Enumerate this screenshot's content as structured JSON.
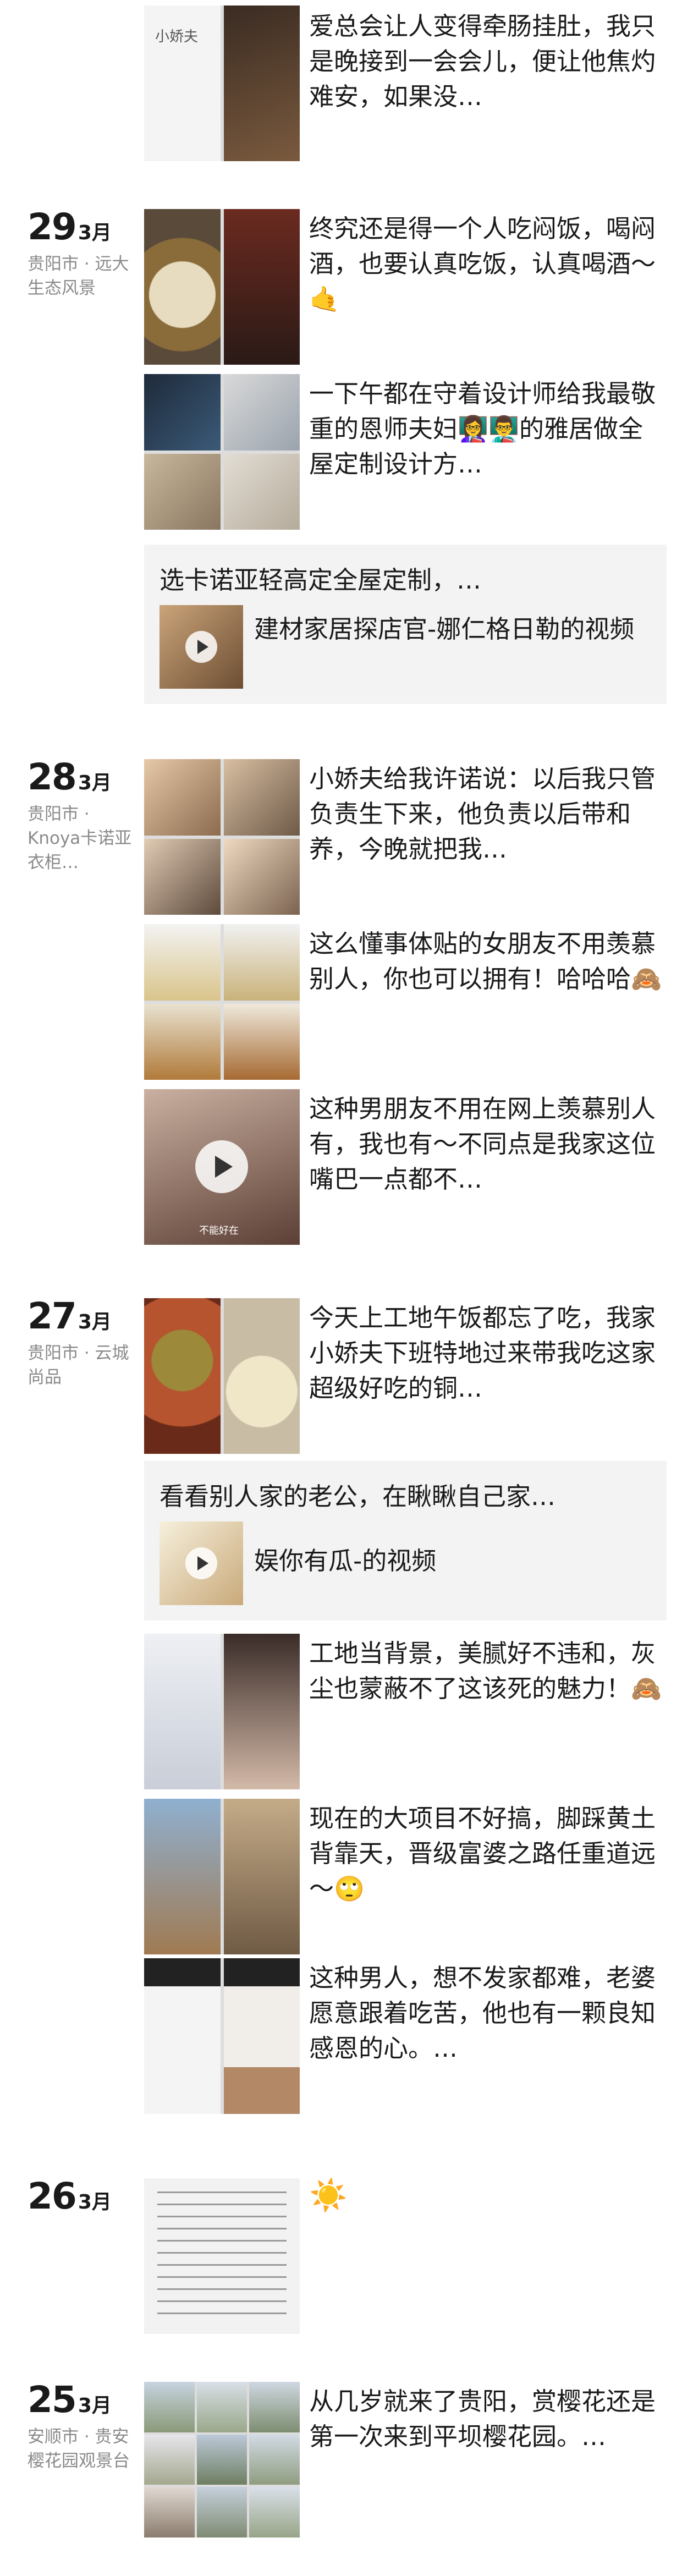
{
  "posts_top": {
    "text": "爱总会让人变得牵肠挂肚，我只是晚接到一会会儿，便让他焦灼难安，如果没…",
    "thumb_caption": "小娇夫"
  },
  "days": [
    {
      "day": "29",
      "month": "3月",
      "location": "贵阳市 · 远大生态风景"
    },
    {
      "day": "28",
      "month": "3月",
      "location": "贵阳市 · Knoya卡诺亚衣柜…"
    },
    {
      "day": "27",
      "month": "3月",
      "location": "贵阳市 · 云城尚品"
    },
    {
      "day": "26",
      "month": "3月",
      "location": ""
    },
    {
      "day": "25",
      "month": "3月",
      "location": "安顺市 · 贵安樱花园观景台"
    }
  ],
  "posts": [
    {
      "text": "终究还是得一个人吃闷饭，喝闷酒，也要认真吃饭，认真喝酒～🤙"
    },
    {
      "text": "一下午都在守着设计师给我最敬重的恩师夫妇👩‍🏫👨‍🏫的雅居做全屋定制设计方…"
    },
    {
      "share_title": "选卡诺亚轻高定全屋定制，…",
      "share_label": "建材家居探店官-娜仁格日勒的视频"
    },
    {
      "text": "小娇夫给我许诺说：以后我只管负责生下来，他负责以后带和养，今晚就把我…"
    },
    {
      "text": "这么懂事体贴的女朋友不用羡慕别人，你也可以拥有！哈哈哈🙈"
    },
    {
      "text": "这种男朋友不用在网上羡慕别人有，我也有～不同点是我家这位嘴巴一点都不…",
      "video_caption": "不能好在"
    },
    {
      "text": "今天上工地午饭都忘了吃，我家小娇夫下班特地过来带我吃这家超级好吃的铜…"
    },
    {
      "share_title": "看看别人家的老公，在瞅瞅自己家…",
      "share_label": "娱你有瓜-的视频"
    },
    {
      "text": "工地当背景，美腻好不违和，灰尘也蒙蔽不了这该死的魅力！🙈"
    },
    {
      "text": "现在的大项目不好搞，脚踩黄土背靠天，晋级富婆之路任重道远～🙄"
    },
    {
      "text": "这种男人，想不发家都难，老婆愿意跟着吃苦，他也有一颗良知感恩的心。…"
    },
    {
      "text": "☀️"
    },
    {
      "text": "从几岁就来了贵阳，赏樱花还是第一次来到平坝樱花园。…"
    }
  ]
}
